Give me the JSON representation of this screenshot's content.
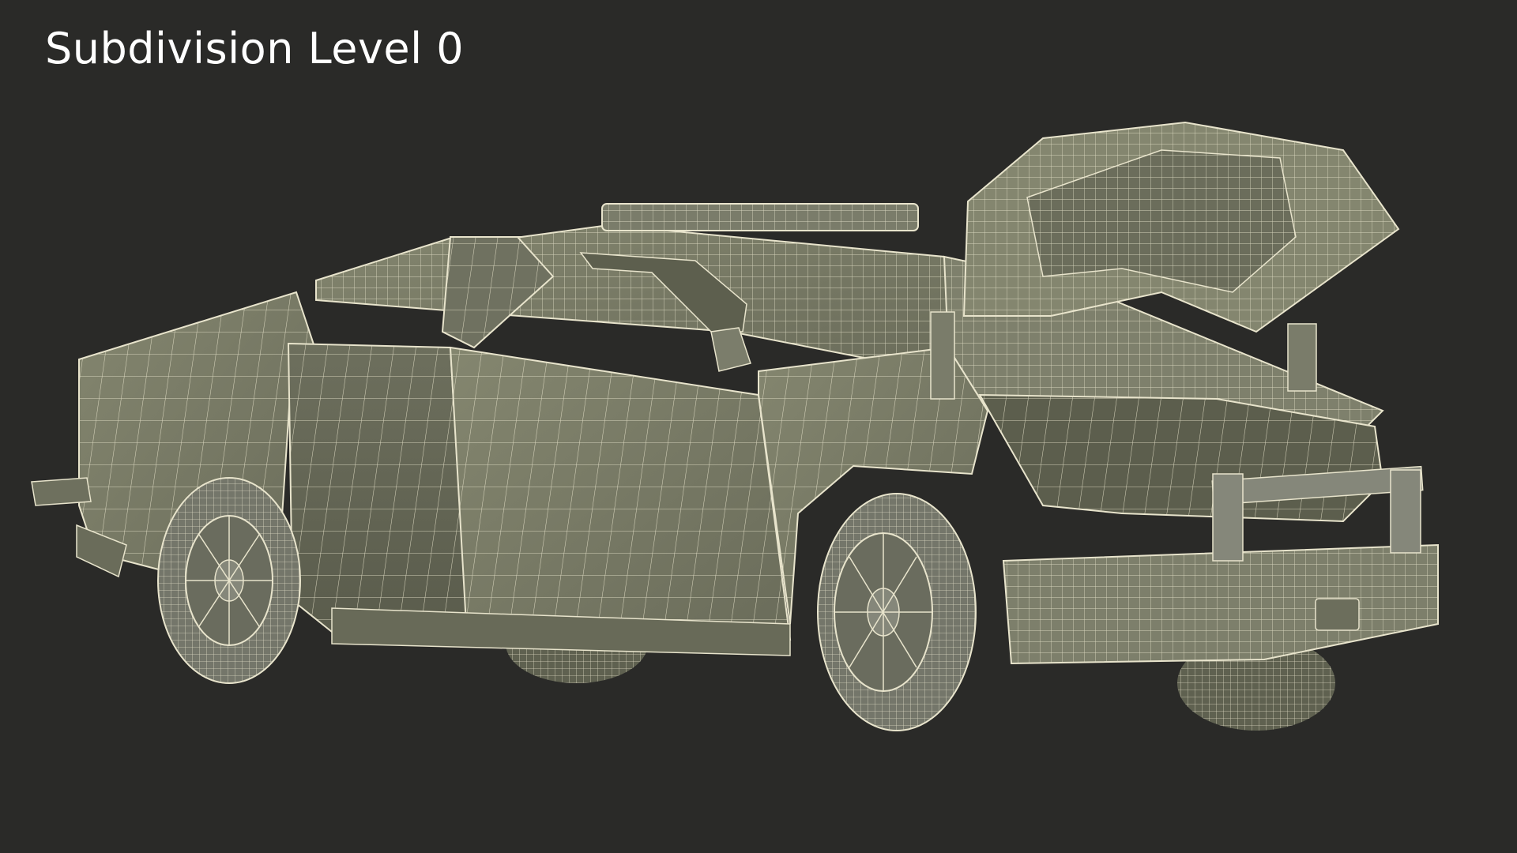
{
  "caption": {
    "text": "Subdivision Level 0"
  },
  "scene": {
    "subject": "wireframe-pickup-truck",
    "background_color": "#2a2a28",
    "mesh_fill_color": "#7a7c6a",
    "wire_color": "#e8e4cc"
  }
}
